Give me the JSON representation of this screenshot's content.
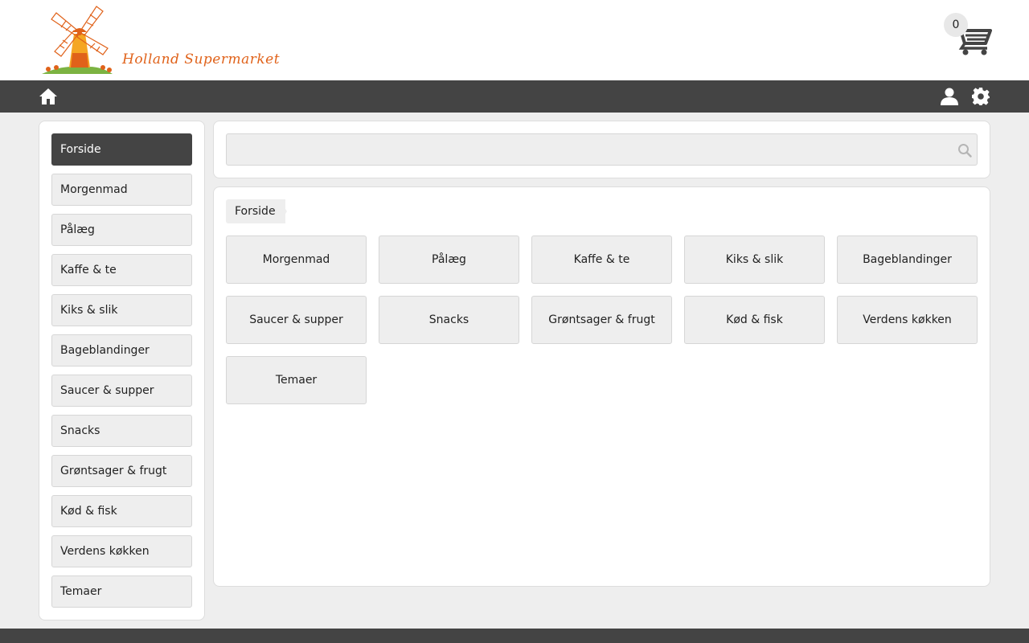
{
  "brand": {
    "logo_text": "Holland Supermarket",
    "accent": "#e0621a"
  },
  "cart": {
    "count": "0",
    "icon": "cart-icon"
  },
  "navbar": {
    "background": "#444444",
    "icons": [
      "home-icon",
      "user-icon",
      "gear-icon"
    ]
  },
  "sidebar": {
    "items": [
      {
        "label": "Forside",
        "active": true
      },
      {
        "label": "Morgenmad"
      },
      {
        "label": "Pålæg"
      },
      {
        "label": "Kaffe & te"
      },
      {
        "label": "Kiks & slik"
      },
      {
        "label": "Bageblandinger"
      },
      {
        "label": "Saucer & supper"
      },
      {
        "label": "Snacks"
      },
      {
        "label": "Grøntsager & frugt"
      },
      {
        "label": "Kød & fisk"
      },
      {
        "label": "Verdens køkken"
      },
      {
        "label": "Temaer"
      }
    ]
  },
  "search": {
    "value": "",
    "placeholder": ""
  },
  "breadcrumb": {
    "items": [
      "Forside"
    ]
  },
  "categories": [
    "Morgenmad",
    "Pålæg",
    "Kaffe & te",
    "Kiks & slik",
    "Bageblandinger",
    "Saucer & supper",
    "Snacks",
    "Grøntsager & frugt",
    "Kød & fisk",
    "Verdens køkken",
    "Temaer"
  ]
}
